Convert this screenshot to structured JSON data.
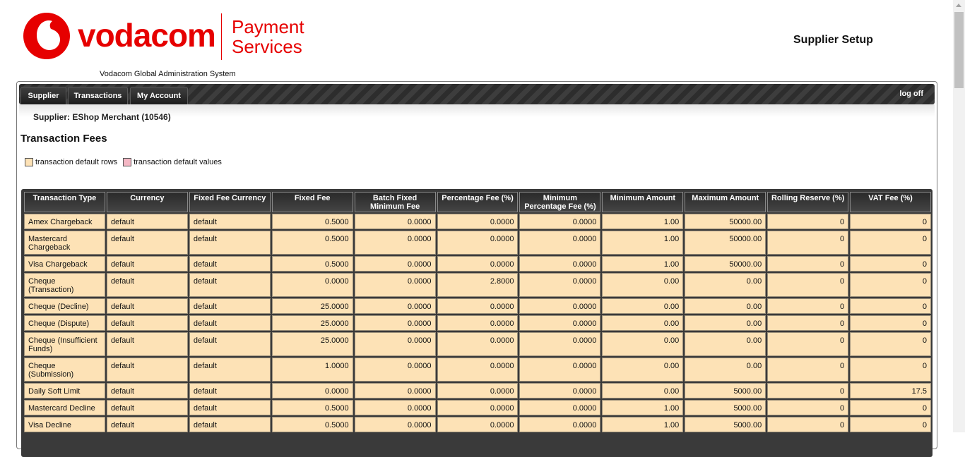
{
  "brand": {
    "wordmark": "vodacom",
    "sub_line1": "Payment",
    "sub_line2": "Services",
    "system_name": "Vodacom Global Administration System",
    "red": "#e60000"
  },
  "page_heading": "Supplier Setup",
  "nav": {
    "tabs": [
      "Supplier",
      "Transactions",
      "My Account"
    ],
    "logoff": "log off"
  },
  "supplier_line": "Supplier: EShop Merchant (10546)",
  "section_title": "Transaction Fees",
  "legend": {
    "rows_label": "transaction default rows",
    "values_label": "transaction default values",
    "rows_color": "#fde2b6",
    "values_color": "#f4b7c4"
  },
  "table": {
    "headers": [
      "Transaction Type",
      "Currency",
      "Fixed Fee Currency",
      "Fixed Fee",
      "Batch Fixed Minimum Fee",
      "Percentage Fee (%)",
      "Minimum Percentage Fee (%)",
      "Minimum Amount",
      "Maximum Amount",
      "Rolling Reserve (%)",
      "VAT Fee (%)"
    ],
    "rows": [
      [
        "Amex Chargeback",
        "default",
        "default",
        "0.5000",
        "0.0000",
        "0.0000",
        "0.0000",
        "1.00",
        "50000.00",
        "0",
        "0"
      ],
      [
        "Mastercard Chargeback",
        "default",
        "default",
        "0.5000",
        "0.0000",
        "0.0000",
        "0.0000",
        "1.00",
        "50000.00",
        "0",
        "0"
      ],
      [
        "Visa Chargeback",
        "default",
        "default",
        "0.5000",
        "0.0000",
        "0.0000",
        "0.0000",
        "1.00",
        "50000.00",
        "0",
        "0"
      ],
      [
        "Cheque (Transaction)",
        "default",
        "default",
        "0.0000",
        "0.0000",
        "2.8000",
        "0.0000",
        "0.00",
        "0.00",
        "0",
        "0"
      ],
      [
        "Cheque (Decline)",
        "default",
        "default",
        "25.0000",
        "0.0000",
        "0.0000",
        "0.0000",
        "0.00",
        "0.00",
        "0",
        "0"
      ],
      [
        "Cheque (Dispute)",
        "default",
        "default",
        "25.0000",
        "0.0000",
        "0.0000",
        "0.0000",
        "0.00",
        "0.00",
        "0",
        "0"
      ],
      [
        "Cheque (Insufficient Funds)",
        "default",
        "default",
        "25.0000",
        "0.0000",
        "0.0000",
        "0.0000",
        "0.00",
        "0.00",
        "0",
        "0"
      ],
      [
        "Cheque (Submission)",
        "default",
        "default",
        "1.0000",
        "0.0000",
        "0.0000",
        "0.0000",
        "0.00",
        "0.00",
        "0",
        "0"
      ],
      [
        "Daily Soft Limit",
        "default",
        "default",
        "0.0000",
        "0.0000",
        "0.0000",
        "0.0000",
        "0.00",
        "5000.00",
        "0",
        "17.5"
      ],
      [
        "Mastercard Decline",
        "default",
        "default",
        "0.5000",
        "0.0000",
        "0.0000",
        "0.0000",
        "1.00",
        "5000.00",
        "0",
        "0"
      ],
      [
        "Visa Decline",
        "default",
        "default",
        "0.5000",
        "0.0000",
        "0.0000",
        "0.0000",
        "1.00",
        "5000.00",
        "0",
        "0"
      ]
    ]
  }
}
